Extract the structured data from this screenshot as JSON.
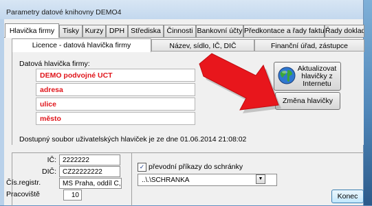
{
  "window": {
    "title": "Parametry datové knihovny  DEMO4"
  },
  "tabs_main": [
    "Hlavička firmy",
    "Tisky",
    "Kurzy",
    "DPH",
    "Střediska",
    "Činnosti",
    "Bankovní účty",
    "Předkontace a řady faktur",
    "Řady dokladů"
  ],
  "tabs_sub": [
    "Licence -  datová hlavička firmy",
    "Název, sídlo, IČ, DIČ",
    "Finanční úřad, zástupce"
  ],
  "header": {
    "label": "Datová hlavička firmy:",
    "lines": [
      "DEMO podvojné UCT",
      "adresa",
      "ulice",
      "město"
    ]
  },
  "buttons": {
    "update_line1": "Aktualizovat",
    "update_line2": "hlavičky z",
    "update_line3": "Internetu",
    "change": "Změna hlavičky",
    "close": "Konec"
  },
  "status": "Dostupný soubor uživatelských hlaviček je ze dne 01.06.2014 21:08:02",
  "fields": {
    "ic_label": "IČ:",
    "ic": "2222222",
    "dic_label": "DIČ:",
    "dic": "CZ22222222",
    "reg_label": "Čís.registr.",
    "reg": "MS Praha, oddíl C, v",
    "work_label": "Pracoviště",
    "work": "10"
  },
  "transfer": {
    "checkbox_label": "převodní příkazy do schránky",
    "checked": true,
    "path": "..\\.\\SCHRANKA"
  },
  "colors": {
    "header_text": "#e0141a",
    "arrow": "#e8161c"
  }
}
